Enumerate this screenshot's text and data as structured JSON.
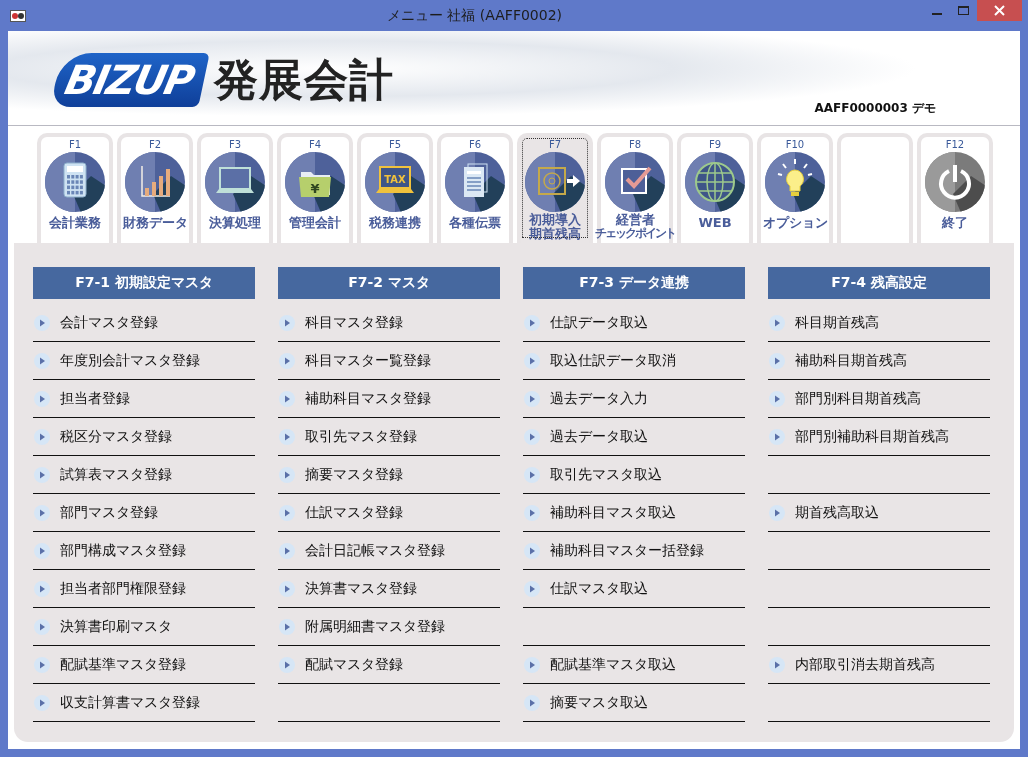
{
  "window": {
    "title": "メニュー 社福 (AAFF0002)"
  },
  "header": {
    "brand": "BIZUP",
    "product": "発展会計",
    "company": "AAFF0000003 デモ"
  },
  "tabs": [
    {
      "kind": "function",
      "key": "F1",
      "label": [
        "会計業務"
      ],
      "selected": false
    },
    {
      "kind": "function",
      "key": "F2",
      "label": [
        "財務データ"
      ],
      "selected": false
    },
    {
      "kind": "function",
      "key": "F3",
      "label": [
        "決算処理"
      ],
      "selected": false
    },
    {
      "kind": "function",
      "key": "F4",
      "label": [
        "管理会計"
      ],
      "icon_text": "¥",
      "selected": false
    },
    {
      "kind": "function",
      "key": "F5",
      "label": [
        "税務連携"
      ],
      "icon_text": "TAX",
      "selected": false
    },
    {
      "kind": "function",
      "key": "F6",
      "label": [
        "各種伝票"
      ],
      "selected": false
    },
    {
      "kind": "function",
      "key": "F7",
      "label": [
        "初期導入",
        "期首残高"
      ],
      "selected": true
    },
    {
      "kind": "function",
      "key": "F8",
      "label": [
        "経営者"
      ],
      "sublabel": "チェックポイント",
      "selected": false
    },
    {
      "kind": "function",
      "key": "F9",
      "label": [
        "WEB"
      ],
      "selected": false
    },
    {
      "kind": "function",
      "key": "F10",
      "label": [
        "オプション"
      ],
      "selected": false
    },
    {
      "kind": "blank"
    },
    {
      "kind": "function",
      "key": "F12",
      "label": [
        "終了"
      ],
      "selected": false
    }
  ],
  "columns": [
    {
      "heading": "F7-1 初期設定マスタ",
      "items": [
        {
          "kind": "link",
          "label": "会計マスタ登録"
        },
        {
          "kind": "link",
          "label": "年度別会計マスタ登録"
        },
        {
          "kind": "link",
          "label": "担当者登録"
        },
        {
          "kind": "link",
          "label": "税区分マスタ登録"
        },
        {
          "kind": "link",
          "label": "試算表マスタ登録"
        },
        {
          "kind": "link",
          "label": "部門マスタ登録"
        },
        {
          "kind": "link",
          "label": "部門構成マスタ登録"
        },
        {
          "kind": "link",
          "label": "担当者部門権限登録"
        },
        {
          "kind": "link",
          "label": "決算書印刷マスタ"
        },
        {
          "kind": "link",
          "label": "配賦基準マスタ登録"
        },
        {
          "kind": "link",
          "label": "収支計算書マスタ登録"
        }
      ]
    },
    {
      "heading": "F7-2 マスタ",
      "items": [
        {
          "kind": "link",
          "label": "科目マスタ登録"
        },
        {
          "kind": "link",
          "label": "科目マスター覧登録"
        },
        {
          "kind": "link",
          "label": "補助科目マスタ登録"
        },
        {
          "kind": "link",
          "label": "取引先マスタ登録"
        },
        {
          "kind": "link",
          "label": "摘要マスタ登録"
        },
        {
          "kind": "link",
          "label": "仕訳マスタ登録"
        },
        {
          "kind": "link",
          "label": "会計日記帳マスタ登録"
        },
        {
          "kind": "link",
          "label": "決算書マスタ登録"
        },
        {
          "kind": "link",
          "label": "附属明細書マスタ登録"
        },
        {
          "kind": "link",
          "label": "配賦マスタ登録"
        },
        {
          "kind": "empty"
        }
      ]
    },
    {
      "heading": "F7-3 データ連携",
      "items": [
        {
          "kind": "link",
          "label": "仕訳データ取込"
        },
        {
          "kind": "link",
          "label": "取込仕訳データ取消"
        },
        {
          "kind": "link",
          "label": "過去データ入力"
        },
        {
          "kind": "link",
          "label": "過去データ取込"
        },
        {
          "kind": "link",
          "label": "取引先マスタ取込"
        },
        {
          "kind": "link",
          "label": "補助科目マスタ取込"
        },
        {
          "kind": "link",
          "label": "補助科目マスター括登録"
        },
        {
          "kind": "link",
          "label": "仕訳マスタ取込"
        },
        {
          "kind": "empty"
        },
        {
          "kind": "link",
          "label": "配賦基準マスタ取込"
        },
        {
          "kind": "link",
          "label": "摘要マスタ取込"
        }
      ]
    },
    {
      "heading": "F7-4 残高設定",
      "items": [
        {
          "kind": "link",
          "label": "科目期首残高"
        },
        {
          "kind": "link",
          "label": "補助科目期首残高"
        },
        {
          "kind": "link",
          "label": "部門別科目期首残高"
        },
        {
          "kind": "link",
          "label": "部門別補助科目期首残高"
        },
        {
          "kind": "empty"
        },
        {
          "kind": "link",
          "label": "期首残高取込"
        },
        {
          "kind": "empty"
        },
        {
          "kind": "empty"
        },
        {
          "kind": "empty"
        },
        {
          "kind": "link",
          "label": "内部取引消去期首残高"
        },
        {
          "kind": "empty"
        }
      ]
    }
  ]
}
